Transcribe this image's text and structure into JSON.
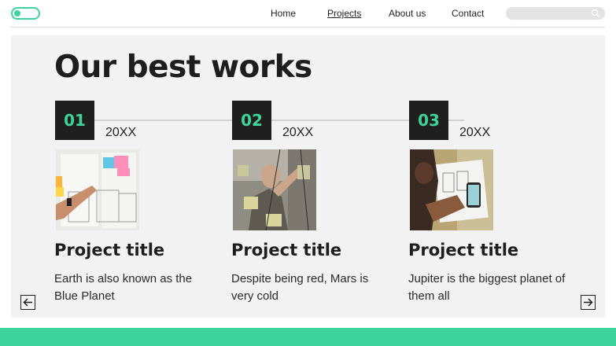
{
  "nav": {
    "items": [
      {
        "label": "Home",
        "active": false
      },
      {
        "label": "Projects",
        "active": true
      },
      {
        "label": "About us",
        "active": false
      },
      {
        "label": "Contact",
        "active": false
      }
    ],
    "search": {
      "placeholder": ""
    }
  },
  "main": {
    "headline": "Our best works",
    "projects": [
      {
        "number": "01",
        "year": "20XX",
        "title": "Project title",
        "description": "Earth is also known as the Blue Planet"
      },
      {
        "number": "02",
        "year": "20XX",
        "title": "Project title",
        "description": "Despite being red, Mars is very cold"
      },
      {
        "number": "03",
        "year": "20XX",
        "title": "Project title",
        "description": "Jupiter is the biggest planet of them all"
      }
    ]
  },
  "colors": {
    "accent": "#3dd39c",
    "dark": "#1f1f1f",
    "panel": "#f2f2f2"
  },
  "icons": {
    "prev": "arrow-left-icon",
    "next": "arrow-right-icon",
    "search": "search-icon",
    "toggle": "toggle-icon"
  }
}
